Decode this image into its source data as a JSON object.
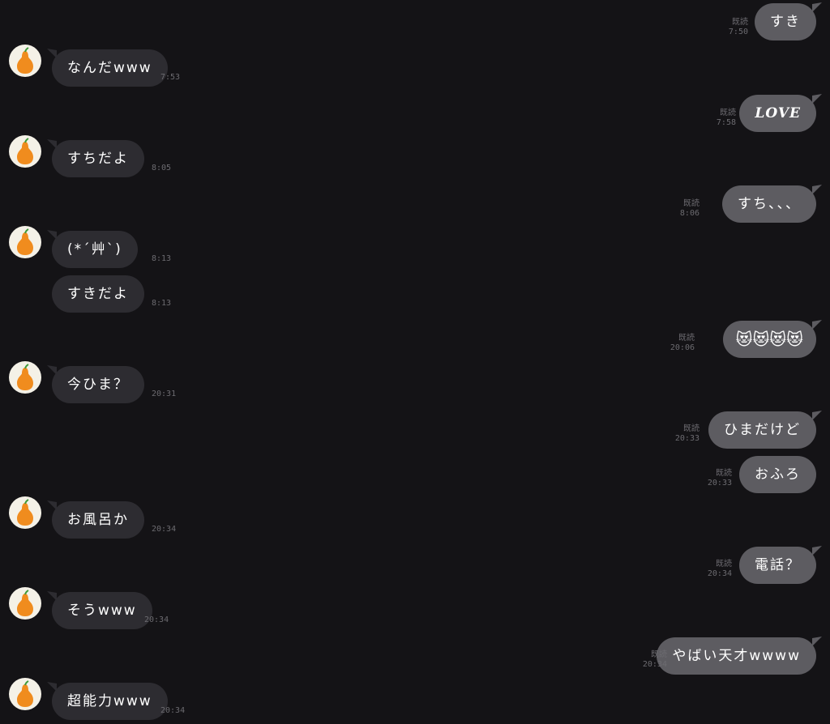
{
  "messages": [
    {
      "side": "out",
      "text": "すき",
      "read": "既読",
      "time": "7:50"
    },
    {
      "side": "in",
      "text": "なんだwww",
      "time": "7:53",
      "avatar": true
    },
    {
      "side": "out",
      "text": "LOVE",
      "read": "既読",
      "time": "7:58",
      "style": "love"
    },
    {
      "side": "in",
      "text": "すちだよ",
      "time": "8:05",
      "avatar": true
    },
    {
      "side": "out",
      "text": "すち、、、",
      "read": "既読",
      "time": "8:06"
    },
    {
      "side": "in",
      "text": "(*´艸`)",
      "time": "8:13",
      "avatar": true
    },
    {
      "side": "in",
      "text": "すきだよ",
      "time": "8:13",
      "avatar": false
    },
    {
      "side": "out",
      "text": "😻😻😻😻",
      "read": "既読",
      "time": "20:06",
      "style": "emoji"
    },
    {
      "side": "in",
      "text": "今ひま？",
      "time": "20:31",
      "avatar": true
    },
    {
      "side": "out",
      "text": "ひまだけど",
      "read": "既読",
      "time": "20:33"
    },
    {
      "side": "out",
      "text": "おふろ",
      "read": "既読",
      "time": "20:33"
    },
    {
      "side": "in",
      "text": "お風呂か",
      "time": "20:34",
      "avatar": true
    },
    {
      "side": "out",
      "text": "電話？",
      "read": "既読",
      "time": "20:34"
    },
    {
      "side": "in",
      "text": "そうwww",
      "time": "20:34",
      "avatar": true
    },
    {
      "side": "out",
      "text": "やばい天才wwww",
      "read": "既読",
      "time": "20:34"
    },
    {
      "side": "in",
      "text": "超能力www",
      "time": "20:34",
      "avatar": true
    }
  ],
  "colors": {
    "background": "#141316",
    "incoming_bubble": "#2d2c31",
    "outgoing_bubble": "#5d5c61",
    "meta_text": "#6c6b70",
    "avatar_background": "#f4f1e7",
    "pear": "#f08c1e",
    "leaf": "#3f9b3a"
  },
  "icons": {
    "avatar": "pear-icon"
  }
}
